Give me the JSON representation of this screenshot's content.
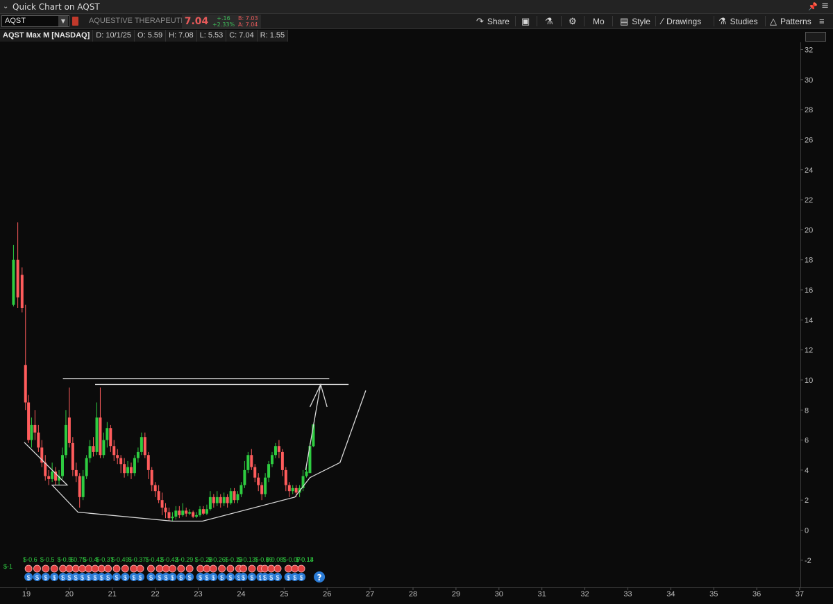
{
  "window": {
    "title": "Quick Chart on AQST"
  },
  "toolbar": {
    "symbol": "AQST",
    "company": "AQUESTIVE THERAPEUTI",
    "last": "7.04",
    "change": "+.16",
    "change_pct": "+2.33%",
    "bid": "B: 7.03",
    "ask": "A: 7.04",
    "share": "Share",
    "mo": "Mo",
    "style": "Style",
    "drawings": "Drawings",
    "studies": "Studies",
    "patterns": "Patterns"
  },
  "info": {
    "name": "AQST Max M [NASDAQ]",
    "date": "D: 10/1/25",
    "open": "O: 5.59",
    "high": "H: 7.08",
    "low": "L: 5.53",
    "close": "C: 7.04",
    "range": "R: 1.55"
  },
  "chart_data": {
    "type": "candlestick",
    "x_ticks": [
      "19",
      "20",
      "21",
      "22",
      "23",
      "24",
      "25",
      "26",
      "27",
      "28",
      "29",
      "30",
      "31",
      "32",
      "33",
      "34",
      "35",
      "36",
      "37"
    ],
    "y_ticks": [
      "32",
      "30",
      "28",
      "26",
      "24",
      "22",
      "20",
      "18",
      "16",
      "14",
      "12",
      "10",
      "8",
      "6",
      "4",
      "2",
      "0",
      "-2"
    ],
    "ylim": [
      -3.2,
      33
    ],
    "xlim": [
      18.6,
      37.1
    ],
    "colors": {
      "up": "#2ecc40",
      "down": "#ff5c5c",
      "drawing": "#d9d9d9"
    },
    "candles": [
      [
        18.7,
        15.0,
        18.0,
        19.0,
        14.9
      ],
      [
        18.8,
        18.0,
        15.5,
        20.5,
        14.8
      ],
      [
        18.9,
        17.0,
        14.8,
        17.5,
        14.5
      ],
      [
        18.98,
        11.0,
        8.5,
        15.0,
        8.0
      ],
      [
        19.05,
        8.5,
        6.0,
        9.0,
        5.8
      ],
      [
        19.12,
        6.0,
        7.0,
        7.5,
        5.5
      ],
      [
        19.2,
        7.0,
        6.5,
        8.0,
        6.0
      ],
      [
        19.28,
        6.5,
        5.5,
        7.0,
        5.2
      ],
      [
        19.36,
        5.5,
        4.5,
        6.0,
        4.2
      ],
      [
        19.44,
        4.5,
        3.6,
        5.0,
        3.3
      ],
      [
        19.52,
        3.6,
        3.4,
        4.0,
        3.0
      ],
      [
        19.6,
        3.4,
        3.9,
        4.5,
        3.2
      ],
      [
        19.68,
        3.9,
        3.3,
        4.2,
        3.0
      ],
      [
        19.76,
        3.3,
        3.6,
        4.0,
        3.0
      ],
      [
        19.84,
        3.6,
        5.0,
        5.5,
        3.4
      ],
      [
        19.92,
        5.0,
        7.0,
        8.0,
        4.8
      ],
      [
        20.0,
        7.5,
        5.8,
        9.5,
        5.5
      ],
      [
        20.08,
        5.8,
        4.0,
        6.2,
        3.6
      ],
      [
        20.16,
        4.0,
        3.6,
        4.5,
        3.2
      ],
      [
        20.24,
        3.6,
        2.2,
        3.8,
        1.5
      ],
      [
        20.32,
        2.2,
        3.6,
        4.0,
        2.0
      ],
      [
        20.4,
        3.6,
        4.8,
        5.0,
        3.4
      ],
      [
        20.48,
        4.8,
        5.6,
        6.0,
        4.5
      ],
      [
        20.56,
        5.6,
        5.2,
        6.2,
        4.9
      ],
      [
        20.64,
        5.2,
        7.5,
        8.5,
        5.0
      ],
      [
        20.72,
        7.5,
        5.0,
        9.5,
        4.8
      ],
      [
        20.8,
        5.0,
        6.0,
        6.5,
        4.8
      ],
      [
        20.88,
        6.0,
        6.8,
        7.2,
        5.5
      ],
      [
        20.96,
        6.8,
        5.6,
        7.0,
        5.2
      ],
      [
        21.04,
        5.6,
        5.0,
        6.0,
        4.6
      ],
      [
        21.12,
        5.0,
        4.8,
        5.4,
        4.4
      ],
      [
        21.2,
        4.8,
        4.4,
        5.0,
        3.8
      ],
      [
        21.28,
        4.4,
        3.8,
        4.8,
        3.5
      ],
      [
        21.36,
        3.8,
        4.2,
        4.6,
        3.6
      ],
      [
        21.44,
        4.2,
        3.8,
        4.5,
        3.4
      ],
      [
        21.52,
        3.8,
        4.8,
        5.0,
        3.6
      ],
      [
        21.6,
        4.8,
        5.2,
        5.5,
        4.5
      ],
      [
        21.68,
        5.2,
        6.2,
        6.5,
        5.0
      ],
      [
        21.76,
        6.2,
        5.0,
        6.5,
        4.8
      ],
      [
        21.84,
        5.0,
        4.0,
        5.2,
        3.4
      ],
      [
        21.92,
        4.0,
        3.0,
        4.2,
        2.6
      ],
      [
        22.0,
        3.0,
        2.6,
        3.2,
        2.2
      ],
      [
        22.08,
        2.6,
        2.0,
        3.0,
        1.8
      ],
      [
        22.16,
        2.0,
        1.5,
        2.5,
        1.0
      ],
      [
        22.24,
        1.5,
        1.2,
        1.8,
        0.8
      ],
      [
        22.32,
        1.2,
        0.8,
        1.5,
        0.6
      ],
      [
        22.4,
        0.8,
        0.9,
        1.2,
        0.6
      ],
      [
        22.48,
        0.9,
        1.3,
        1.6,
        0.7
      ],
      [
        22.56,
        1.3,
        1.0,
        1.6,
        0.8
      ],
      [
        22.64,
        1.0,
        1.3,
        1.8,
        0.9
      ],
      [
        22.72,
        1.3,
        1.1,
        1.5,
        0.9
      ],
      [
        22.8,
        1.1,
        1.2,
        1.4,
        1.0
      ],
      [
        22.88,
        1.2,
        0.9,
        1.3,
        0.8
      ],
      [
        22.96,
        0.9,
        1.0,
        1.2,
        0.8
      ],
      [
        23.04,
        1.0,
        1.4,
        1.6,
        0.9
      ],
      [
        23.12,
        1.4,
        1.1,
        1.6,
        1.0
      ],
      [
        23.2,
        1.1,
        1.4,
        1.7,
        1.0
      ],
      [
        23.28,
        1.4,
        2.2,
        2.6,
        1.3
      ],
      [
        23.36,
        2.2,
        1.8,
        2.4,
        1.5
      ],
      [
        23.44,
        1.8,
        2.2,
        2.6,
        1.6
      ],
      [
        23.52,
        2.2,
        1.8,
        2.4,
        1.5
      ],
      [
        23.6,
        1.8,
        2.2,
        2.5,
        1.6
      ],
      [
        23.68,
        2.2,
        1.8,
        2.4,
        1.5
      ],
      [
        23.76,
        1.8,
        2.6,
        2.8,
        1.7
      ],
      [
        23.84,
        2.6,
        2.0,
        2.8,
        1.8
      ],
      [
        23.92,
        2.0,
        2.4,
        2.6,
        1.8
      ],
      [
        24.0,
        2.4,
        3.0,
        3.2,
        2.2
      ],
      [
        24.08,
        3.0,
        4.0,
        4.6,
        2.8
      ],
      [
        24.16,
        4.0,
        5.0,
        5.2,
        3.8
      ],
      [
        24.24,
        5.0,
        4.2,
        5.4,
        4.0
      ],
      [
        24.32,
        4.2,
        3.5,
        4.4,
        3.2
      ],
      [
        24.4,
        3.5,
        3.0,
        3.8,
        2.6
      ],
      [
        24.48,
        3.0,
        2.4,
        3.2,
        2.0
      ],
      [
        24.56,
        2.4,
        3.5,
        3.8,
        2.2
      ],
      [
        24.64,
        3.5,
        4.4,
        4.6,
        3.2
      ],
      [
        24.72,
        4.4,
        5.0,
        5.2,
        4.2
      ],
      [
        24.8,
        5.0,
        5.6,
        5.8,
        4.8
      ],
      [
        24.88,
        5.6,
        5.2,
        6.0,
        4.8
      ],
      [
        24.96,
        5.2,
        4.0,
        5.4,
        3.6
      ],
      [
        25.04,
        4.0,
        3.0,
        4.2,
        2.6
      ],
      [
        25.12,
        3.0,
        2.6,
        3.2,
        2.2
      ],
      [
        25.2,
        2.6,
        2.8,
        3.0,
        2.4
      ],
      [
        25.28,
        2.8,
        2.5,
        3.0,
        2.2
      ],
      [
        25.36,
        2.5,
        2.8,
        3.0,
        2.2
      ],
      [
        25.44,
        2.8,
        3.6,
        4.0,
        2.6
      ],
      [
        25.52,
        3.6,
        3.9,
        4.2,
        3.5
      ],
      [
        25.6,
        3.8,
        5.6,
        5.8,
        3.8
      ],
      [
        25.68,
        5.59,
        7.04,
        7.08,
        5.53
      ]
    ],
    "drawings": {
      "lines": [
        [
          [
            19.85,
            10.1
          ],
          [
            26.05,
            10.1
          ]
        ],
        [
          [
            20.6,
            9.7
          ],
          [
            26.5,
            9.7
          ]
        ],
        [
          [
            18.95,
            5.85
          ],
          [
            19.95,
            3.0
          ],
          [
            19.6,
            3.0
          ],
          [
            20.2,
            1.2
          ],
          [
            22.4,
            0.6
          ],
          [
            23.1,
            0.6
          ],
          [
            25.25,
            2.2
          ],
          [
            25.6,
            3.5
          ],
          [
            26.3,
            4.5
          ],
          [
            26.9,
            9.3
          ]
        ]
      ],
      "arrow": [
        [
          25.5,
          4.0
        ],
        [
          25.85,
          9.7
        ],
        [
          25.6,
          8.2
        ],
        [
          25.85,
          9.7
        ],
        [
          26.0,
          8.2
        ]
      ]
    },
    "event_labels": [
      "$-0.6",
      "$-0.5",
      "$-0.5",
      "$0.75",
      "$-0.4",
      "$-0.37",
      "$-0.49",
      "$-0.37",
      "$-0.42",
      "$-0.42",
      "$-0.29",
      "$-0.28",
      "$-0.26",
      "$-0.13",
      "$-0.13",
      "$-0.09",
      "$-0.08",
      "$-0.07",
      "$-0.13",
      "$-0.14",
      "$-1"
    ],
    "events": {
      "earnings_x": [
        19.05,
        19.25,
        19.45,
        19.65,
        19.85,
        20.0,
        20.15,
        20.3,
        20.45,
        20.6,
        20.75,
        20.9,
        21.1,
        21.3,
        21.5,
        21.65,
        21.9,
        22.1,
        22.25,
        22.4,
        22.6,
        22.8,
        23.05,
        23.2,
        23.35,
        23.55,
        23.75,
        23.95,
        24.05,
        24.25,
        24.45,
        24.55,
        24.7,
        24.85,
        25.1,
        25.25,
        25.4
      ]
    }
  }
}
